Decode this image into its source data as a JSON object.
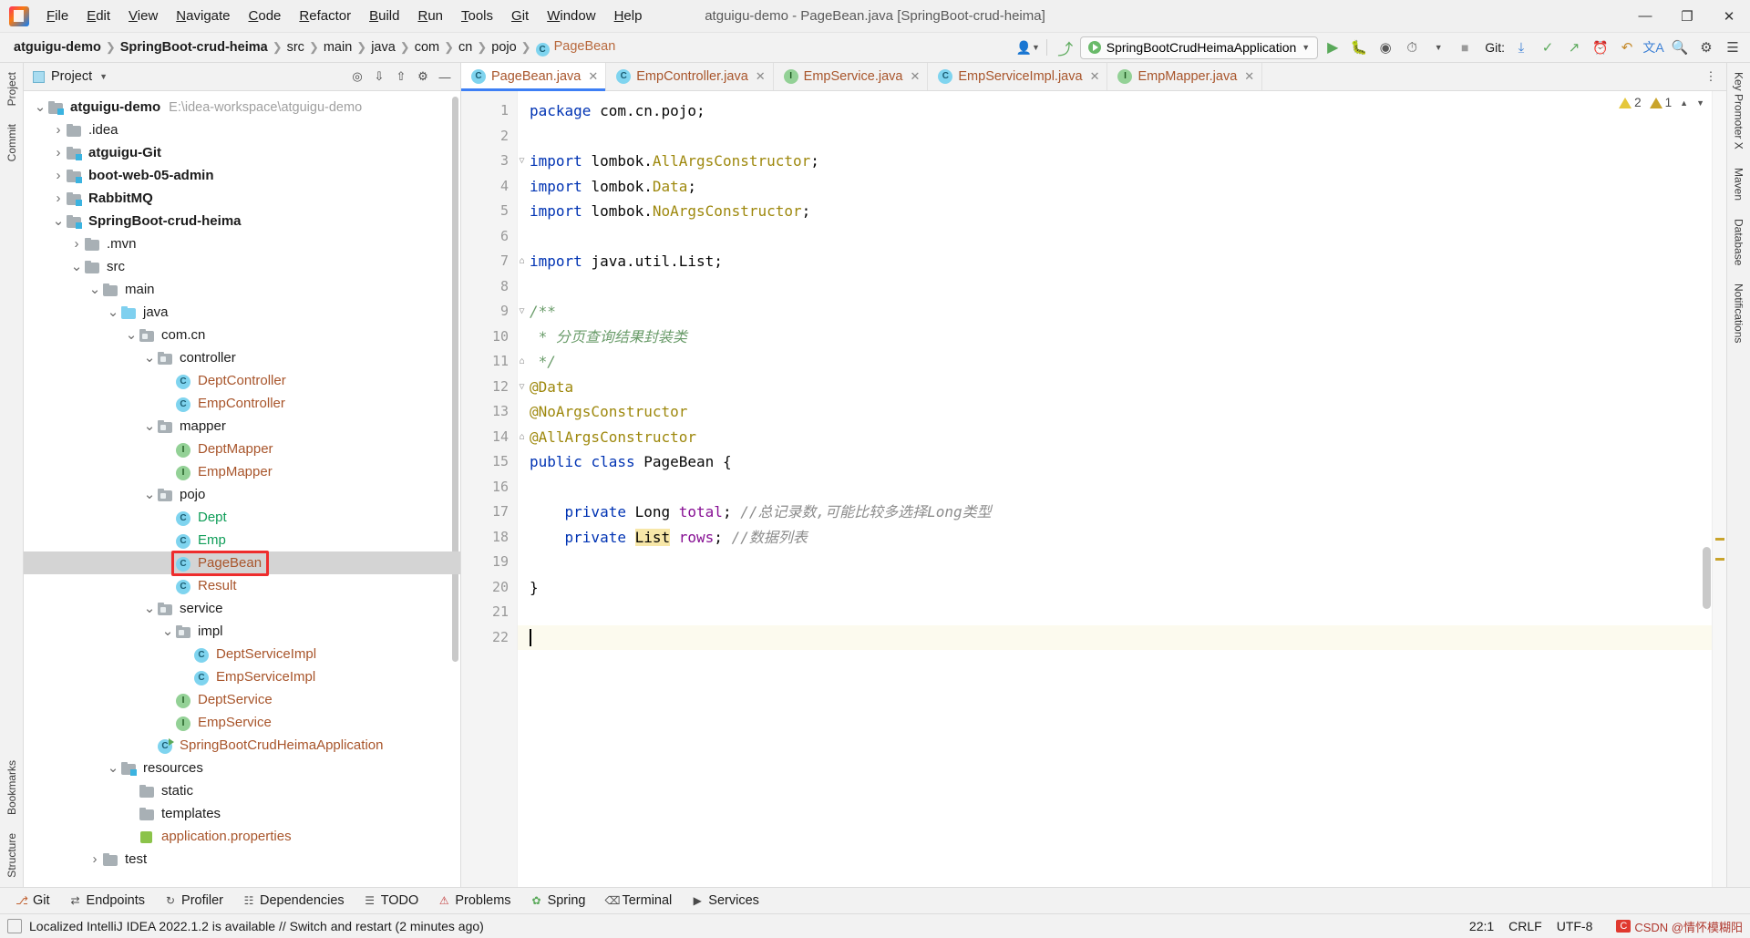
{
  "window": {
    "title": "atguigu-demo - PageBean.java [SpringBoot-crud-heima]",
    "minimize": "—",
    "maximize": "❐",
    "close": "✕"
  },
  "menu": [
    {
      "label": "File"
    },
    {
      "label": "Edit"
    },
    {
      "label": "View"
    },
    {
      "label": "Navigate"
    },
    {
      "label": "Code"
    },
    {
      "label": "Refactor"
    },
    {
      "label": "Build"
    },
    {
      "label": "Run"
    },
    {
      "label": "Tools"
    },
    {
      "label": "Git"
    },
    {
      "label": "Window"
    },
    {
      "label": "Help"
    }
  ],
  "breadcrumbs": [
    {
      "label": "atguigu-demo",
      "style": "bold"
    },
    {
      "label": "SpringBoot-crud-heima",
      "style": "bold"
    },
    {
      "label": "src",
      "style": "plain"
    },
    {
      "label": "main",
      "style": "plain"
    },
    {
      "label": "java",
      "style": "plain"
    },
    {
      "label": "com",
      "style": "plain"
    },
    {
      "label": "cn",
      "style": "plain"
    },
    {
      "label": "pojo",
      "style": "plain"
    },
    {
      "label": "PageBean",
      "style": "class"
    }
  ],
  "toolbar": {
    "run_configuration": "SpringBootCrudHeimaApplication",
    "git_label": "Git:",
    "icons": [
      "user-settings-icon",
      "updates-icon",
      "run-icon",
      "debug-icon",
      "run-with-coverage-icon",
      "profiler-icon",
      "stop-icon",
      "git-update-icon",
      "git-commit-icon",
      "git-push-icon",
      "search-everywhere-icon",
      "settings-icon",
      "history-icon",
      "undo-icon",
      "translate-icon"
    ]
  },
  "project_panel": {
    "title": "Project",
    "actions": [
      "target-icon",
      "expand-icon",
      "collapse-icon",
      "settings-icon",
      "hide-icon"
    ],
    "tree": [
      {
        "indent": 0,
        "arrow": "down",
        "icon": "module",
        "label": "atguigu-demo",
        "style": "bold",
        "hint": "E:\\idea-workspace\\atguigu-demo"
      },
      {
        "indent": 1,
        "arrow": "right",
        "icon": "folder",
        "label": ".idea",
        "style": "plain",
        "hint": ""
      },
      {
        "indent": 1,
        "arrow": "right",
        "icon": "module",
        "label": "atguigu-Git",
        "style": "bold",
        "hint": ""
      },
      {
        "indent": 1,
        "arrow": "right",
        "icon": "module",
        "label": "boot-web-05-admin",
        "style": "bold",
        "hint": ""
      },
      {
        "indent": 1,
        "arrow": "right",
        "icon": "module",
        "label": "RabbitMQ",
        "style": "bold",
        "hint": ""
      },
      {
        "indent": 1,
        "arrow": "down",
        "icon": "module",
        "label": "SpringBoot-crud-heima",
        "style": "bold",
        "hint": ""
      },
      {
        "indent": 2,
        "arrow": "right",
        "icon": "folder",
        "label": ".mvn",
        "style": "plain",
        "hint": ""
      },
      {
        "indent": 2,
        "arrow": "down",
        "icon": "folder",
        "label": "src",
        "style": "plain",
        "hint": ""
      },
      {
        "indent": 3,
        "arrow": "down",
        "icon": "folder",
        "label": "main",
        "style": "plain",
        "hint": ""
      },
      {
        "indent": 4,
        "arrow": "down",
        "icon": "source-folder",
        "label": "java",
        "style": "plain",
        "hint": ""
      },
      {
        "indent": 5,
        "arrow": "down",
        "icon": "package",
        "label": "com.cn",
        "style": "plain",
        "hint": ""
      },
      {
        "indent": 6,
        "arrow": "down",
        "icon": "package",
        "label": "controller",
        "style": "plain",
        "hint": ""
      },
      {
        "indent": 7,
        "arrow": "none",
        "icon": "class",
        "label": "DeptController",
        "style": "class",
        "hint": ""
      },
      {
        "indent": 7,
        "arrow": "none",
        "icon": "class",
        "label": "EmpController",
        "style": "class",
        "hint": ""
      },
      {
        "indent": 6,
        "arrow": "down",
        "icon": "package",
        "label": "mapper",
        "style": "plain",
        "hint": ""
      },
      {
        "indent": 7,
        "arrow": "none",
        "icon": "interface",
        "label": "DeptMapper",
        "style": "class",
        "hint": ""
      },
      {
        "indent": 7,
        "arrow": "none",
        "icon": "interface",
        "label": "EmpMapper",
        "style": "class",
        "hint": ""
      },
      {
        "indent": 6,
        "arrow": "down",
        "icon": "package",
        "label": "pojo",
        "style": "plain",
        "hint": ""
      },
      {
        "indent": 7,
        "arrow": "none",
        "icon": "class",
        "label": "Dept",
        "style": "green",
        "hint": ""
      },
      {
        "indent": 7,
        "arrow": "none",
        "icon": "class",
        "label": "Emp",
        "style": "green",
        "hint": ""
      },
      {
        "indent": 7,
        "arrow": "none",
        "icon": "class",
        "label": "PageBean",
        "style": "class",
        "hint": "",
        "selected": true,
        "highlighted": true
      },
      {
        "indent": 7,
        "arrow": "none",
        "icon": "class",
        "label": "Result",
        "style": "class",
        "hint": ""
      },
      {
        "indent": 6,
        "arrow": "down",
        "icon": "package",
        "label": "service",
        "style": "plain",
        "hint": ""
      },
      {
        "indent": 7,
        "arrow": "down",
        "icon": "package",
        "label": "impl",
        "style": "plain",
        "hint": ""
      },
      {
        "indent": 8,
        "arrow": "none",
        "icon": "class",
        "label": "DeptServiceImpl",
        "style": "class",
        "hint": ""
      },
      {
        "indent": 8,
        "arrow": "none",
        "icon": "class",
        "label": "EmpServiceImpl",
        "style": "class",
        "hint": ""
      },
      {
        "indent": 7,
        "arrow": "none",
        "icon": "interface",
        "label": "DeptService",
        "style": "class",
        "hint": ""
      },
      {
        "indent": 7,
        "arrow": "none",
        "icon": "interface",
        "label": "EmpService",
        "style": "class",
        "hint": ""
      },
      {
        "indent": 6,
        "arrow": "none",
        "icon": "spring",
        "label": "SpringBootCrudHeimaApplication",
        "style": "class",
        "hint": ""
      },
      {
        "indent": 4,
        "arrow": "down",
        "icon": "resource-folder",
        "label": "resources",
        "style": "plain",
        "hint": ""
      },
      {
        "indent": 5,
        "arrow": "none",
        "icon": "folder",
        "label": "static",
        "style": "plain",
        "hint": ""
      },
      {
        "indent": 5,
        "arrow": "none",
        "icon": "folder",
        "label": "templates",
        "style": "plain",
        "hint": ""
      },
      {
        "indent": 5,
        "arrow": "none",
        "icon": "properties",
        "label": "application.properties",
        "style": "class",
        "hint": ""
      },
      {
        "indent": 3,
        "arrow": "right",
        "icon": "folder",
        "label": "test",
        "style": "plain",
        "hint": ""
      }
    ]
  },
  "left_rail": [
    "Project",
    "Commit"
  ],
  "right_rail": [
    "Key Promoter X",
    "Maven",
    "Database",
    "Notifications"
  ],
  "bottom_rail": [
    "Bookmarks",
    "Structure"
  ],
  "editor": {
    "tabs": [
      {
        "label": "PageBean.java",
        "icon": "class",
        "active": true
      },
      {
        "label": "EmpController.java",
        "icon": "class",
        "active": false
      },
      {
        "label": "EmpService.java",
        "icon": "interface",
        "active": false
      },
      {
        "label": "EmpServiceImpl.java",
        "icon": "class",
        "active": false
      },
      {
        "label": "EmpMapper.java",
        "icon": "interface",
        "active": false
      }
    ],
    "warning_count": "2",
    "weak_warning_count": "1",
    "lines": [
      {
        "n": 1,
        "fold": "",
        "segments": [
          {
            "t": "package ",
            "c": "kw"
          },
          {
            "t": "com.cn.pojo;",
            "c": "plain"
          }
        ]
      },
      {
        "n": 2,
        "fold": "",
        "segments": []
      },
      {
        "n": 3,
        "fold": "-",
        "segments": [
          {
            "t": "import ",
            "c": "kw"
          },
          {
            "t": "lombok.",
            "c": "plain"
          },
          {
            "t": "AllArgsConstructor",
            "c": "ann"
          },
          {
            "t": ";",
            "c": "plain"
          }
        ]
      },
      {
        "n": 4,
        "fold": "",
        "segments": [
          {
            "t": "import ",
            "c": "kw"
          },
          {
            "t": "lombok.",
            "c": "plain"
          },
          {
            "t": "Data",
            "c": "ann"
          },
          {
            "t": ";",
            "c": "plain"
          }
        ]
      },
      {
        "n": 5,
        "fold": "",
        "segments": [
          {
            "t": "import ",
            "c": "kw"
          },
          {
            "t": "lombok.",
            "c": "plain"
          },
          {
            "t": "NoArgsConstructor",
            "c": "ann"
          },
          {
            "t": ";",
            "c": "plain"
          }
        ]
      },
      {
        "n": 6,
        "fold": "",
        "segments": []
      },
      {
        "n": 7,
        "fold": "^",
        "segments": [
          {
            "t": "import ",
            "c": "kw"
          },
          {
            "t": "java.util.List;",
            "c": "plain"
          }
        ]
      },
      {
        "n": 8,
        "fold": "",
        "segments": []
      },
      {
        "n": 9,
        "fold": "-",
        "segments": [
          {
            "t": "/**",
            "c": "doc"
          }
        ]
      },
      {
        "n": 10,
        "fold": "",
        "segments": [
          {
            "t": " * ",
            "c": "doc"
          },
          {
            "t": "分页查询结果封装类",
            "c": "doc"
          }
        ]
      },
      {
        "n": 11,
        "fold": "^",
        "segments": [
          {
            "t": " */",
            "c": "doc"
          }
        ]
      },
      {
        "n": 12,
        "fold": "-",
        "segments": [
          {
            "t": "@Data",
            "c": "ann"
          }
        ]
      },
      {
        "n": 13,
        "fold": "",
        "segments": [
          {
            "t": "@NoArgsConstructor",
            "c": "ann"
          }
        ]
      },
      {
        "n": 14,
        "fold": "^",
        "segments": [
          {
            "t": "@AllArgsConstructor",
            "c": "ann"
          }
        ]
      },
      {
        "n": 15,
        "fold": "",
        "segments": [
          {
            "t": "public ",
            "c": "kw"
          },
          {
            "t": "class ",
            "c": "kw"
          },
          {
            "t": "PageBean ",
            "c": "plain"
          },
          {
            "t": "{",
            "c": "plain"
          }
        ]
      },
      {
        "n": 16,
        "fold": "",
        "segments": []
      },
      {
        "n": 17,
        "fold": "",
        "segments": [
          {
            "t": "    ",
            "c": "plain"
          },
          {
            "t": "private ",
            "c": "kw"
          },
          {
            "t": "Long ",
            "c": "plain"
          },
          {
            "t": "total",
            "c": "fld"
          },
          {
            "t": "; ",
            "c": "plain"
          },
          {
            "t": "//总记录数,可能比较多选择Long类型",
            "c": "cmt"
          }
        ]
      },
      {
        "n": 18,
        "fold": "",
        "segments": [
          {
            "t": "    ",
            "c": "plain"
          },
          {
            "t": "private ",
            "c": "kw"
          },
          {
            "t": "List",
            "c": "hl"
          },
          {
            "t": " ",
            "c": "plain"
          },
          {
            "t": "rows",
            "c": "fld"
          },
          {
            "t": "; ",
            "c": "plain"
          },
          {
            "t": "//数据列表",
            "c": "cmt"
          }
        ]
      },
      {
        "n": 19,
        "fold": "",
        "segments": []
      },
      {
        "n": 20,
        "fold": "",
        "segments": [
          {
            "t": "}",
            "c": "plain"
          }
        ]
      },
      {
        "n": 21,
        "fold": "",
        "segments": []
      },
      {
        "n": 22,
        "fold": "",
        "segments": [],
        "caret": true
      }
    ]
  },
  "tool_windows": [
    {
      "label": "Git",
      "icon": "git-icon"
    },
    {
      "label": "Endpoints",
      "icon": "endpoints-icon"
    },
    {
      "label": "Profiler",
      "icon": "profiler-icon"
    },
    {
      "label": "Dependencies",
      "icon": "dependencies-icon"
    },
    {
      "label": "TODO",
      "icon": "todo-icon"
    },
    {
      "label": "Problems",
      "icon": "problems-icon"
    },
    {
      "label": "Spring",
      "icon": "spring-icon"
    },
    {
      "label": "Terminal",
      "icon": "terminal-icon"
    },
    {
      "label": "Services",
      "icon": "services-icon"
    }
  ],
  "status_bar": {
    "message": "Localized IntelliJ IDEA 2022.1.2 is available // Switch and restart (2 minutes ago)",
    "caret_position": "22:1",
    "line_separator": "CRLF",
    "encoding": "UTF-8",
    "watermark": "CSDN @情怀模糊阳"
  },
  "colors": {
    "accent_blue": "#3d7ff5",
    "class_orange": "#a8552b",
    "annotation_gold": "#9e880d",
    "keyword_blue": "#0033b3",
    "field_purple": "#871094",
    "comment_grey": "#8c8c8c",
    "doc_green": "#6a9c6a",
    "highlight_red": "#ee2d2d",
    "selection_grey": "#d4d4d4"
  }
}
